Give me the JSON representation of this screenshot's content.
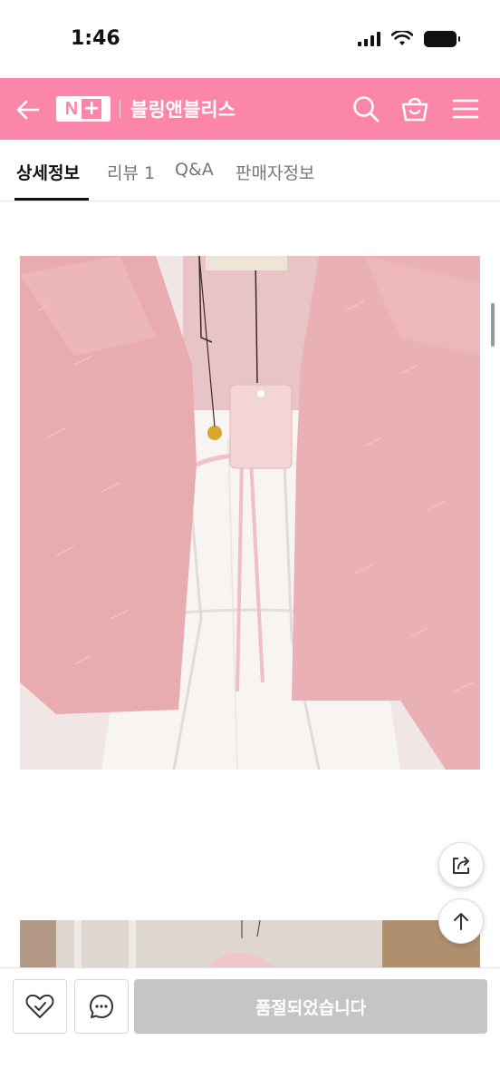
{
  "status_bar": {
    "time": "1:46"
  },
  "header": {
    "logo_letter": "N",
    "logo_plus": "+",
    "shop_name": "블링앤블리스"
  },
  "tabs": [
    {
      "label": "상세정보"
    },
    {
      "label": "리뷰 1"
    },
    {
      "label": "Q&A"
    },
    {
      "label": "판매자정보"
    }
  ],
  "bottom_bar": {
    "sold_out_label": "품절되었습니다"
  },
  "colors": {
    "header_bg": "#fb86aa",
    "sold_out_bg": "#c5c5c5"
  }
}
